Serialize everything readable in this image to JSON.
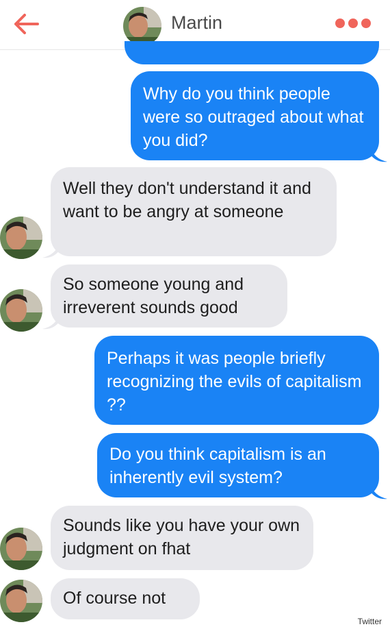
{
  "header": {
    "contact_name": "Martin"
  },
  "icons": {
    "back": "back-arrow-icon",
    "more": "more-dots-icon",
    "avatar": "contact-avatar"
  },
  "colors": {
    "accent": "#f0655b",
    "outgoing": "#1a83f5",
    "incoming": "#e8e8ec"
  },
  "messages": [
    {
      "from": "me",
      "text": "Why do you think people were so outraged about what you did?"
    },
    {
      "from": "martin",
      "text": "Well they don't understand it and want to be angry at someone"
    },
    {
      "from": "martin",
      "text": "So someone young and irreverent sounds good"
    },
    {
      "from": "me",
      "text": "Perhaps it was people briefly recognizing the evils of capitalism ??"
    },
    {
      "from": "me",
      "text": "Do you think capitalism is an inherently evil system?"
    },
    {
      "from": "martin",
      "text": "Sounds like you have your own judgment on fhat"
    },
    {
      "from": "martin",
      "text": "Of course not"
    }
  ],
  "credit": "Twitter"
}
